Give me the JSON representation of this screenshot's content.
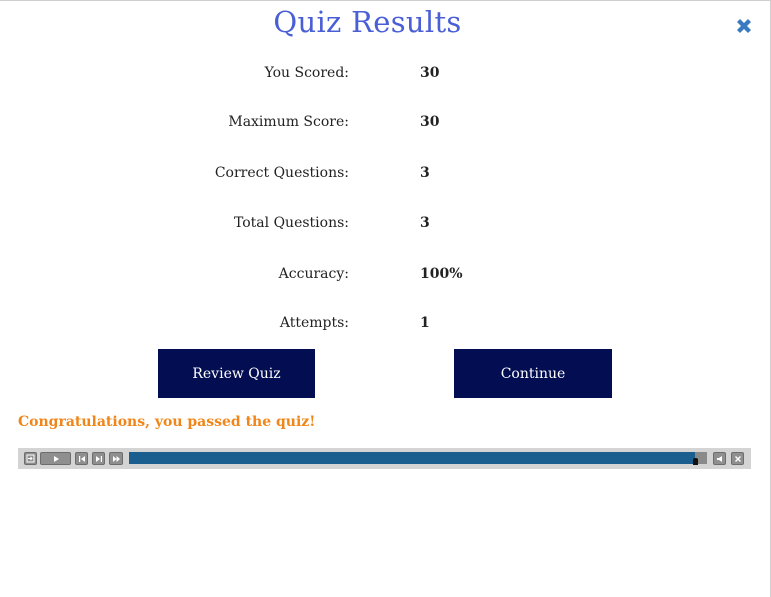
{
  "title": "Quiz Results",
  "close_icon": "close-x-icon",
  "stats": [
    {
      "label": "You Scored:",
      "value": "30"
    },
    {
      "label": "Maximum Score:",
      "value": "30"
    },
    {
      "label": "Correct Questions:",
      "value": "3"
    },
    {
      "label": "Total Questions:",
      "value": "3"
    },
    {
      "label": "Accuracy:",
      "value": "100%"
    },
    {
      "label": "Attempts:",
      "value": "1"
    }
  ],
  "buttons": {
    "review": "Review Quiz",
    "continue": "Continue"
  },
  "message": "Congratulations, you passed the quiz!",
  "playbar": {
    "progress_fraction": 0.98,
    "controls": [
      "exit-icon",
      "play-icon",
      "rewind-icon",
      "step-forward-icon",
      "fast-forward-icon",
      "audio-icon",
      "close-icon"
    ]
  },
  "colors": {
    "title": "#4a5fd6",
    "button_bg": "#030d52",
    "message": "#f0861a",
    "progress": "#1a5e8f",
    "close_icon": "#3a7ac0"
  }
}
